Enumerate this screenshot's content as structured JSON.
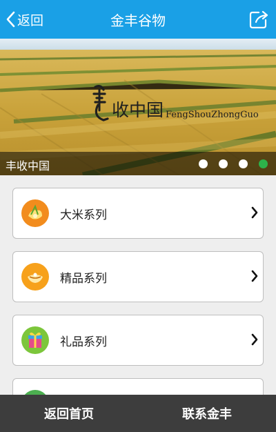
{
  "header": {
    "back_label": "返回",
    "title": "金丰谷物"
  },
  "banner": {
    "logo_text": "收中国",
    "logo_pinyin": "FengShouZhongGuo",
    "caption": "丰收中国",
    "slide_count": 4,
    "active_slide": 4
  },
  "menu": {
    "items": [
      {
        "label": "大米系列",
        "icon": "rice-icon",
        "color": "#f28c1d"
      },
      {
        "label": "精品系列",
        "icon": "premium-icon",
        "color": "#f7a11b"
      },
      {
        "label": "礼品系列",
        "icon": "gift-icon",
        "color": "#7cc63b"
      },
      {
        "label": "",
        "icon": "item-icon",
        "color": "#4caf50"
      }
    ]
  },
  "footer": {
    "home_label": "返回首页",
    "contact_label": "联系金丰"
  },
  "colors": {
    "header": "#1aa0e6",
    "footer": "#3d3d3d",
    "active_dot": "#2db34a"
  }
}
